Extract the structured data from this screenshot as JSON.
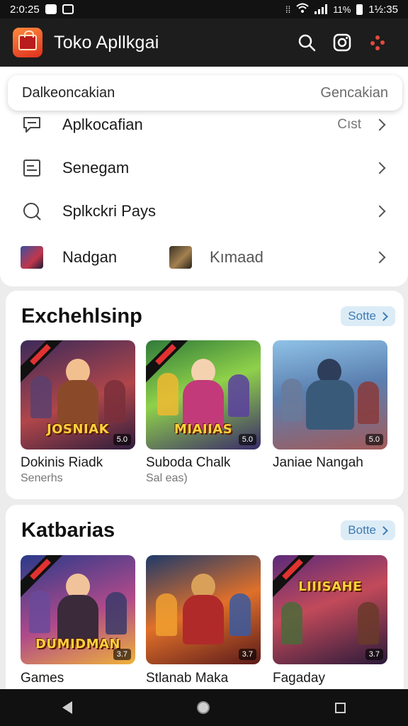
{
  "status_bar": {
    "time": "2:0:25",
    "right_time": "1½:35",
    "battery": "11%"
  },
  "app_bar": {
    "title": "Toko Apllkgai"
  },
  "search": {
    "value": "Dalkeoncakian",
    "action": "Gencakian"
  },
  "menu": [
    {
      "label": "Aplkocafian",
      "meta": "Cıst",
      "icon": "chat-bubble-icon"
    },
    {
      "label": "Senegam",
      "meta": "",
      "icon": "list-doc-icon"
    },
    {
      "label": "Splkckri Pays",
      "meta": "",
      "icon": "search-circle-icon"
    }
  ],
  "shortcuts": {
    "left": "Nadgan",
    "right": "Kımaad"
  },
  "sections": [
    {
      "heading": "Exchehlsinp",
      "more": "Sotte",
      "items": [
        {
          "title": "Dokinis Riadk",
          "subtitle": "Senerhs",
          "art": "JOSNIAK",
          "badge": "5.0"
        },
        {
          "title": "Suboda Chalk",
          "subtitle": "Sal eas)",
          "art": "MIAIIAS",
          "badge": "5.0"
        },
        {
          "title": "Janiae Nangah",
          "subtitle": "",
          "art": "",
          "badge": "5.0"
        }
      ]
    },
    {
      "heading": "Katbarias",
      "more": "Botte",
      "items": [
        {
          "title": "Games",
          "subtitle": "",
          "art": "DUMIDMAN",
          "badge": "3.7"
        },
        {
          "title": "Stlanab Maka",
          "subtitle": "",
          "art": "",
          "badge": "3.7"
        },
        {
          "title": "Fagaday",
          "subtitle": "",
          "art": "LIIISAHE",
          "badge": "3.7"
        }
      ]
    }
  ],
  "colors": {
    "accent": "#3f7bb0",
    "appbar": "#1d1d1d",
    "logo": "#e0301e"
  }
}
